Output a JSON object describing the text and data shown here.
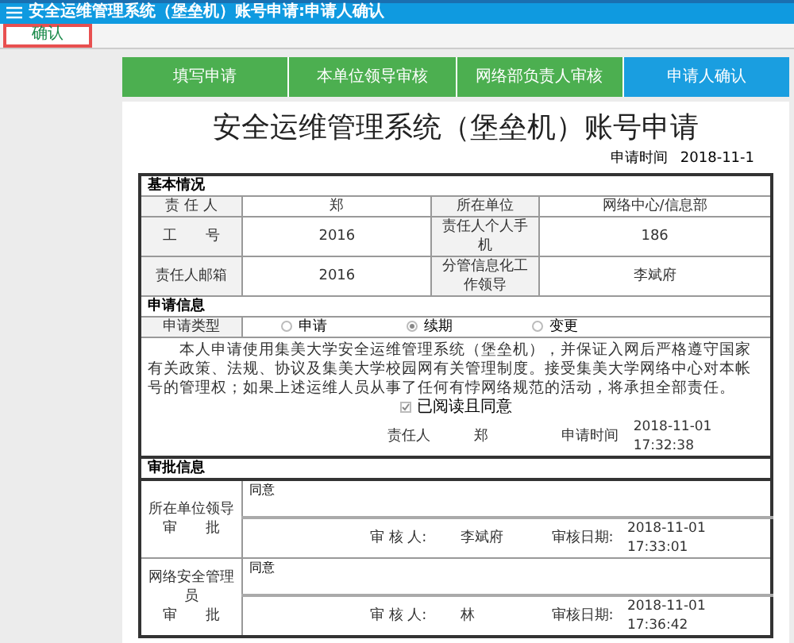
{
  "header": {
    "title": "安全运维管理系统（堡垒机）账号申请:申请人确认"
  },
  "toolbar": {
    "buttons": [
      "确认"
    ]
  },
  "steps": [
    {
      "label": "填写申请",
      "selected": false
    },
    {
      "label": "本单位领导审核",
      "selected": false
    },
    {
      "label": "网络部负责人审核",
      "selected": false
    },
    {
      "label": "申请人确认",
      "selected": true
    }
  ],
  "form": {
    "title": "安全运维管理系统（堡垒机）账号申请",
    "apply_time_label": "申请时间",
    "apply_time": "2018-11-1",
    "basic": {
      "heading": "基本情况",
      "rows": [
        {
          "label1": "责 任 人",
          "value1": "郑",
          "label2": "所在单位",
          "value2": "网络中心/信息部"
        },
        {
          "label1": "工　　号",
          "value1": "2016",
          "label2": "责任人个人手机",
          "value2": "186"
        },
        {
          "label1": "责任人邮箱",
          "value1": "2016",
          "label2": "分管信息化工作领导",
          "value2": "李斌府"
        }
      ]
    },
    "application": {
      "heading": "申请信息",
      "type_label": "申请类型",
      "types": [
        {
          "label": "申请",
          "selected": false
        },
        {
          "label": "续期",
          "selected": true
        },
        {
          "label": "变更",
          "selected": false
        }
      ],
      "statement": "本人申请使用集美大学安全运维管理系统（堡垒机），并保证入网后严格遵守国家有关政策、法规、协议及集美大学校园网有关管理制度。接受集美大学网络中心对本帐号的管理权；如果上述运维人员从事了任何有悖网络规范的活动，将承担全部责任。",
      "agree": {
        "label": "已阅读且同意",
        "checked": true
      },
      "signer_label": "责任人",
      "signer": "郑",
      "time_label": "申请时间",
      "time": "2018-11-01 17:32:38"
    },
    "approval": {
      "heading": "审批信息",
      "items": [
        {
          "label": "所在单位领导",
          "label2": "审　　批",
          "comment": "同意",
          "reviewer_label": "审 核 人:",
          "reviewer": "李斌府",
          "date_label": "审核日期:",
          "date": "2018-11-01 17:33:01"
        },
        {
          "label": "网络安全管理员",
          "label2": "审　　批",
          "comment": "同意",
          "reviewer_label": "审 核 人:",
          "reviewer": "林",
          "date_label": "审核日期:",
          "date": "2018-11-01 17:36:42"
        }
      ]
    }
  }
}
